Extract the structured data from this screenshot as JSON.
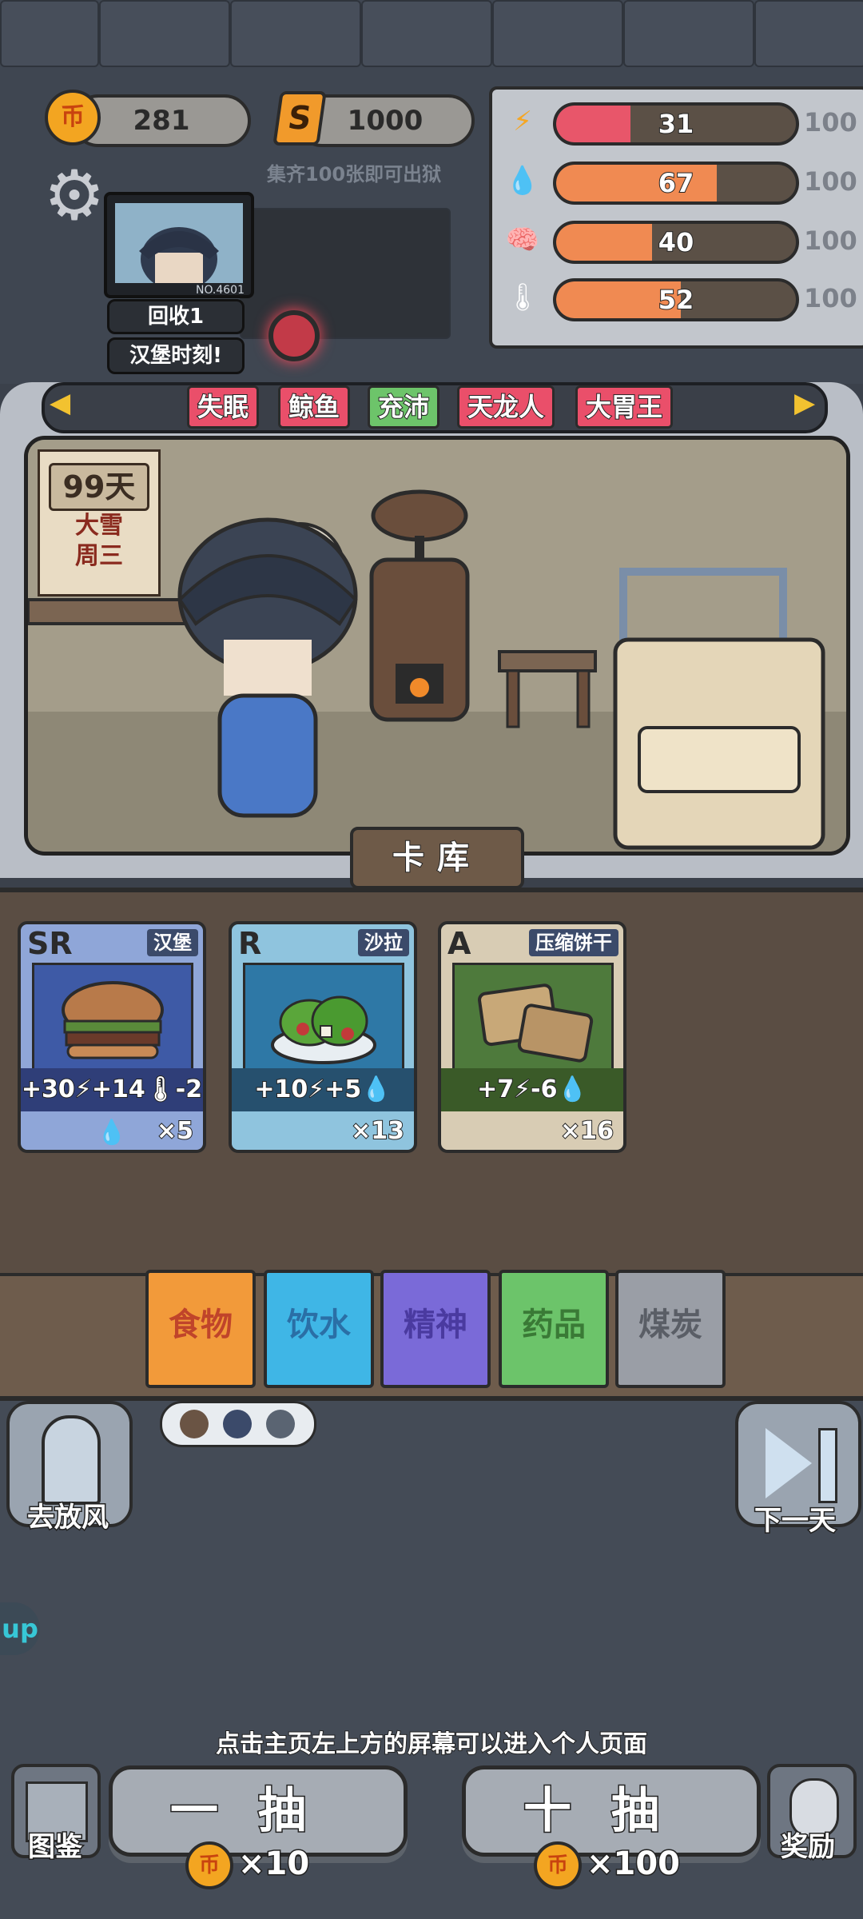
{
  "currency": {
    "coins": "281",
    "coin_symbol": "币",
    "s_points": "1000",
    "s_symbol": "S"
  },
  "hint_top": "集齐100张即可出狱",
  "profile": {
    "id": "NO.4601",
    "label1": "回收1",
    "label2": "汉堡时刻!"
  },
  "stats": [
    {
      "icon": "energy-icon",
      "glyph": "⚡",
      "value": "31",
      "max": "100",
      "fraction": 0.31,
      "color": "#e8566a"
    },
    {
      "icon": "water-icon",
      "glyph": "💧",
      "value": "67",
      "max": "100",
      "fraction": 0.67,
      "color": "#f08a52"
    },
    {
      "icon": "brain-icon",
      "glyph": "🧠",
      "value": "40",
      "max": "100",
      "fraction": 0.4,
      "color": "#f08a52"
    },
    {
      "icon": "temperature-icon",
      "glyph": "🌡",
      "value": "52",
      "max": "100",
      "fraction": 0.52,
      "color": "#f08a52"
    }
  ],
  "tags": [
    {
      "label": "失眠",
      "color": "#ea4f6a"
    },
    {
      "label": "鲸鱼",
      "color": "#ea4f6a"
    },
    {
      "label": "充沛",
      "color": "#6dc46a"
    },
    {
      "label": "天龙人",
      "color": "#ea4f6a"
    },
    {
      "label": "大胃王",
      "color": "#ea4f6a"
    }
  ],
  "calendar": {
    "day": "99天",
    "weather": "大雪",
    "weekday": "周三"
  },
  "card_tab": "卡库",
  "cards": [
    {
      "rarity": "SR",
      "name": "汉堡",
      "effect": "+30⚡+14🌡-2💧",
      "count": "×5",
      "bg": "#8fa6d8",
      "art": "#3e5aa6",
      "band": "#2f3e78"
    },
    {
      "rarity": "R",
      "name": "沙拉",
      "effect": "+10⚡+5💧",
      "count": "×13",
      "bg": "#8fc4de",
      "art": "#2e78a6",
      "band": "#26506e"
    },
    {
      "rarity": "A",
      "name": "压缩饼干",
      "effect": "+7⚡-6💧",
      "count": "×16",
      "bg": "#d8ccb4",
      "art": "#4e7a3c",
      "band": "#3a5a28"
    }
  ],
  "categories": [
    {
      "label": "食物",
      "color": "#f29a3a",
      "text": "#c0442a"
    },
    {
      "label": "饮水",
      "color": "#3fb6e6",
      "text": "#2a6fa6"
    },
    {
      "label": "精神",
      "color": "#7a6ad8",
      "text": "#4a3aa0"
    },
    {
      "label": "药品",
      "color": "#6cc46a",
      "text": "#3a7a36"
    },
    {
      "label": "煤炭",
      "color": "#9a9ea6",
      "text": "#5a5e66"
    }
  ],
  "actions": {
    "go_out": "去放风",
    "next_day": "下一天",
    "tip": "点击主页左上方的屏幕可以进入个人页面",
    "gallery": "图鉴",
    "reward": "奖励",
    "side_tab": "up"
  },
  "draw": {
    "single_label": "一抽",
    "single_cost": "×10",
    "ten_label": "十抽",
    "ten_cost": "×100"
  }
}
